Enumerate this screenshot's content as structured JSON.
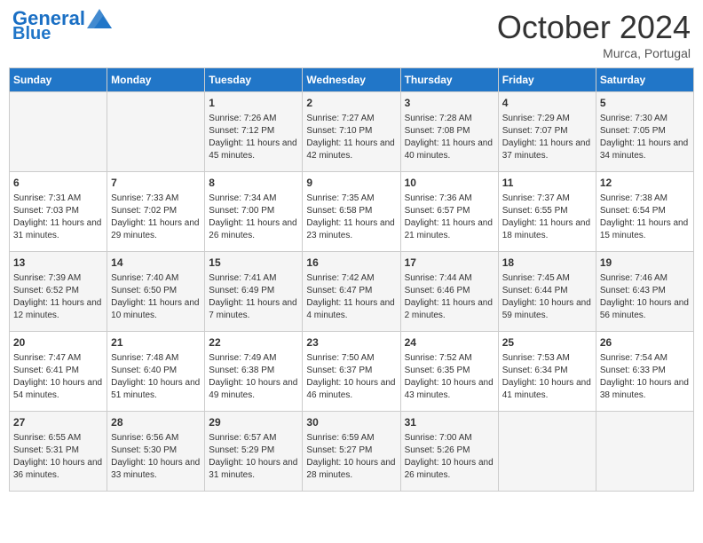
{
  "header": {
    "logo_line1": "General",
    "logo_line2": "Blue",
    "month": "October 2024",
    "location": "Murca, Portugal"
  },
  "weekdays": [
    "Sunday",
    "Monday",
    "Tuesday",
    "Wednesday",
    "Thursday",
    "Friday",
    "Saturday"
  ],
  "weeks": [
    [
      {
        "day": "",
        "info": ""
      },
      {
        "day": "",
        "info": ""
      },
      {
        "day": "1",
        "info": "Sunrise: 7:26 AM\nSunset: 7:12 PM\nDaylight: 11 hours and 45 minutes."
      },
      {
        "day": "2",
        "info": "Sunrise: 7:27 AM\nSunset: 7:10 PM\nDaylight: 11 hours and 42 minutes."
      },
      {
        "day": "3",
        "info": "Sunrise: 7:28 AM\nSunset: 7:08 PM\nDaylight: 11 hours and 40 minutes."
      },
      {
        "day": "4",
        "info": "Sunrise: 7:29 AM\nSunset: 7:07 PM\nDaylight: 11 hours and 37 minutes."
      },
      {
        "day": "5",
        "info": "Sunrise: 7:30 AM\nSunset: 7:05 PM\nDaylight: 11 hours and 34 minutes."
      }
    ],
    [
      {
        "day": "6",
        "info": "Sunrise: 7:31 AM\nSunset: 7:03 PM\nDaylight: 11 hours and 31 minutes."
      },
      {
        "day": "7",
        "info": "Sunrise: 7:33 AM\nSunset: 7:02 PM\nDaylight: 11 hours and 29 minutes."
      },
      {
        "day": "8",
        "info": "Sunrise: 7:34 AM\nSunset: 7:00 PM\nDaylight: 11 hours and 26 minutes."
      },
      {
        "day": "9",
        "info": "Sunrise: 7:35 AM\nSunset: 6:58 PM\nDaylight: 11 hours and 23 minutes."
      },
      {
        "day": "10",
        "info": "Sunrise: 7:36 AM\nSunset: 6:57 PM\nDaylight: 11 hours and 21 minutes."
      },
      {
        "day": "11",
        "info": "Sunrise: 7:37 AM\nSunset: 6:55 PM\nDaylight: 11 hours and 18 minutes."
      },
      {
        "day": "12",
        "info": "Sunrise: 7:38 AM\nSunset: 6:54 PM\nDaylight: 11 hours and 15 minutes."
      }
    ],
    [
      {
        "day": "13",
        "info": "Sunrise: 7:39 AM\nSunset: 6:52 PM\nDaylight: 11 hours and 12 minutes."
      },
      {
        "day": "14",
        "info": "Sunrise: 7:40 AM\nSunset: 6:50 PM\nDaylight: 11 hours and 10 minutes."
      },
      {
        "day": "15",
        "info": "Sunrise: 7:41 AM\nSunset: 6:49 PM\nDaylight: 11 hours and 7 minutes."
      },
      {
        "day": "16",
        "info": "Sunrise: 7:42 AM\nSunset: 6:47 PM\nDaylight: 11 hours and 4 minutes."
      },
      {
        "day": "17",
        "info": "Sunrise: 7:44 AM\nSunset: 6:46 PM\nDaylight: 11 hours and 2 minutes."
      },
      {
        "day": "18",
        "info": "Sunrise: 7:45 AM\nSunset: 6:44 PM\nDaylight: 10 hours and 59 minutes."
      },
      {
        "day": "19",
        "info": "Sunrise: 7:46 AM\nSunset: 6:43 PM\nDaylight: 10 hours and 56 minutes."
      }
    ],
    [
      {
        "day": "20",
        "info": "Sunrise: 7:47 AM\nSunset: 6:41 PM\nDaylight: 10 hours and 54 minutes."
      },
      {
        "day": "21",
        "info": "Sunrise: 7:48 AM\nSunset: 6:40 PM\nDaylight: 10 hours and 51 minutes."
      },
      {
        "day": "22",
        "info": "Sunrise: 7:49 AM\nSunset: 6:38 PM\nDaylight: 10 hours and 49 minutes."
      },
      {
        "day": "23",
        "info": "Sunrise: 7:50 AM\nSunset: 6:37 PM\nDaylight: 10 hours and 46 minutes."
      },
      {
        "day": "24",
        "info": "Sunrise: 7:52 AM\nSunset: 6:35 PM\nDaylight: 10 hours and 43 minutes."
      },
      {
        "day": "25",
        "info": "Sunrise: 7:53 AM\nSunset: 6:34 PM\nDaylight: 10 hours and 41 minutes."
      },
      {
        "day": "26",
        "info": "Sunrise: 7:54 AM\nSunset: 6:33 PM\nDaylight: 10 hours and 38 minutes."
      }
    ],
    [
      {
        "day": "27",
        "info": "Sunrise: 6:55 AM\nSunset: 5:31 PM\nDaylight: 10 hours and 36 minutes."
      },
      {
        "day": "28",
        "info": "Sunrise: 6:56 AM\nSunset: 5:30 PM\nDaylight: 10 hours and 33 minutes."
      },
      {
        "day": "29",
        "info": "Sunrise: 6:57 AM\nSunset: 5:29 PM\nDaylight: 10 hours and 31 minutes."
      },
      {
        "day": "30",
        "info": "Sunrise: 6:59 AM\nSunset: 5:27 PM\nDaylight: 10 hours and 28 minutes."
      },
      {
        "day": "31",
        "info": "Sunrise: 7:00 AM\nSunset: 5:26 PM\nDaylight: 10 hours and 26 minutes."
      },
      {
        "day": "",
        "info": ""
      },
      {
        "day": "",
        "info": ""
      }
    ]
  ]
}
